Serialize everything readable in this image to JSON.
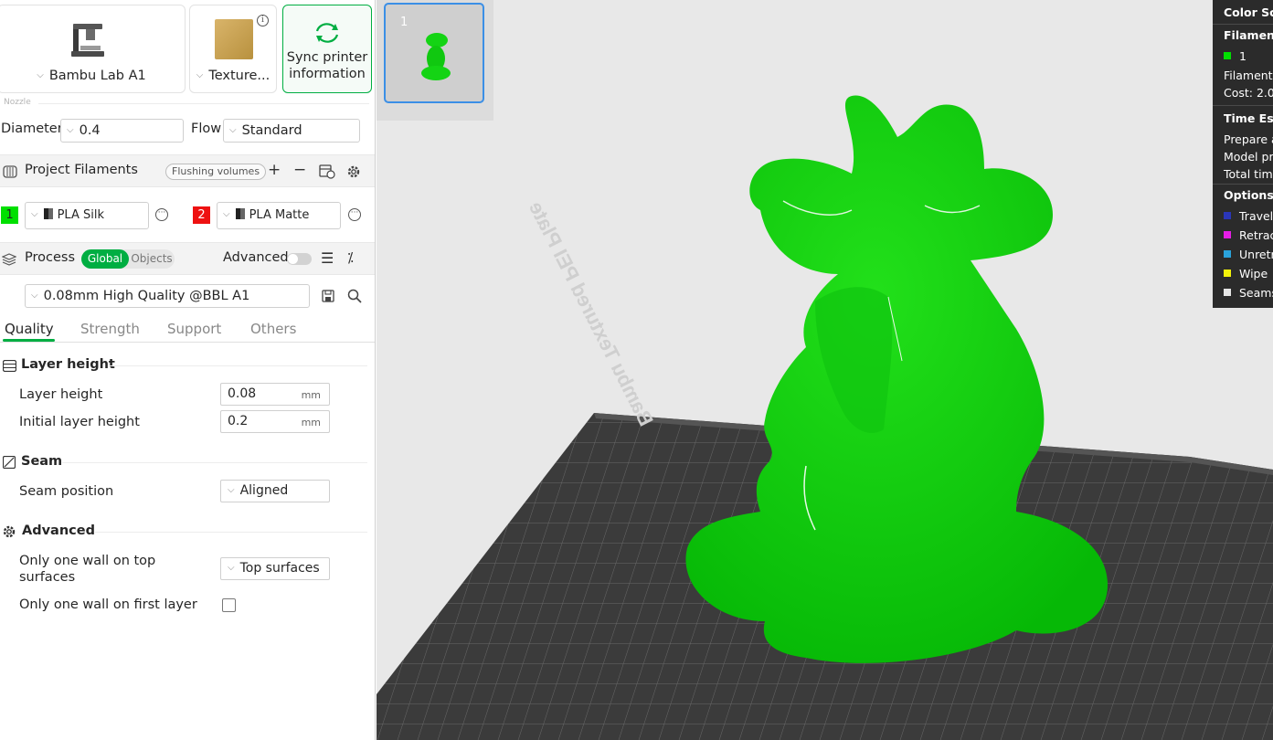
{
  "printer": {
    "name": "Bambu Lab A1",
    "plate": "Texture...",
    "sync_label_line1": "Sync printer",
    "sync_label_line2": "information"
  },
  "nozzle": {
    "section": "Nozzle",
    "diameter_label": "Diameter",
    "diameter_value": "0.4",
    "flow_label": "Flow",
    "flow_value": "Standard"
  },
  "filaments": {
    "title": "Project Filaments",
    "flushing_button": "Flushing volumes",
    "items": [
      {
        "index": "1",
        "color": "#00e000",
        "name": "PLA Silk"
      },
      {
        "index": "2",
        "color": "#ee1111",
        "name": "PLA Matte"
      }
    ]
  },
  "process": {
    "title": "Process",
    "mode_global": "Global",
    "mode_objects": "Objects",
    "advanced_label": "Advanced",
    "preset": "0.08mm High Quality @BBL A1",
    "tabs": [
      "Quality",
      "Strength",
      "Support",
      "Others"
    ]
  },
  "quality": {
    "layer_height_group": "Layer height",
    "layer_height_label": "Layer height",
    "layer_height_value": "0.08",
    "initial_layer_label": "Initial layer height",
    "initial_layer_value": "0.2",
    "unit": "mm",
    "seam_group": "Seam",
    "seam_position_label": "Seam position",
    "seam_position_value": "Aligned",
    "advanced_group": "Advanced",
    "one_wall_top_label_l1": "Only one wall on top",
    "one_wall_top_label_l2": "surfaces",
    "one_wall_top_value": "Top surfaces",
    "one_wall_first_label": "Only one wall on first layer"
  },
  "viewport": {
    "plate_number": "1",
    "plate_text": "Bambu Textured PEI Plate"
  },
  "legend": {
    "color_scheme": "Color Sch",
    "filament_header": "Filament",
    "filament_1": "1",
    "filament_1_color": "#00e000",
    "filament_row": "Filament",
    "cost_row": "Cost:  2.0",
    "time_header": "Time Esti",
    "prepare": "Prepare a",
    "model_print": "Model pri",
    "total_time": "Total time",
    "options_header": "Options",
    "options": [
      {
        "label": "Travel",
        "color": "#2a36b8"
      },
      {
        "label": "Retrac",
        "color": "#e61de6"
      },
      {
        "label": "Unretr",
        "color": "#2aa3dc"
      },
      {
        "label": "Wipe",
        "color": "#f2f20a"
      },
      {
        "label": "Seams",
        "color": "#e6e6e6"
      }
    ]
  }
}
